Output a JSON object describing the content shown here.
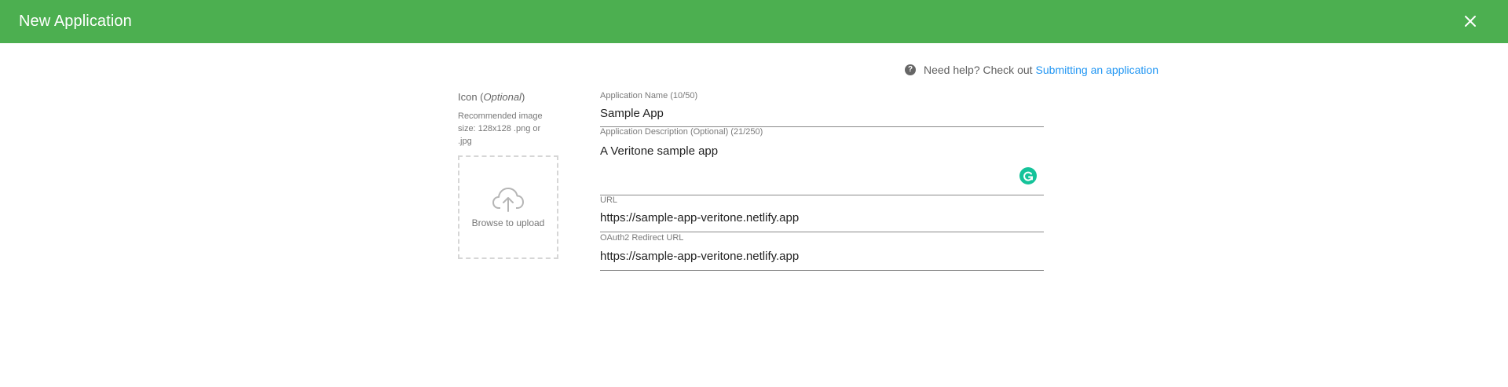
{
  "header": {
    "title": "New Application",
    "accent_color": "#4caf50",
    "close_icon": "close-icon"
  },
  "help": {
    "icon": "question-circle-icon",
    "text": "Need help? Check out",
    "link_text": "Submitting an application",
    "link_color": "#2196f3"
  },
  "icon_section": {
    "label": "Icon (",
    "label_optional": "Optional",
    "label_close": ")",
    "hint": "Recommended image size: 128x128 .png or .jpg",
    "upload_icon": "cloud-upload-icon",
    "upload_text": "Browse to upload"
  },
  "form": {
    "name": {
      "label": "Application Name (10/50)",
      "value": "Sample App"
    },
    "description": {
      "label": "Application Description (Optional) (21/250)",
      "value": "A Veritone sample app"
    },
    "url": {
      "label": "URL",
      "value": "https://sample-app-veritone.netlify.app"
    },
    "oauth": {
      "label": "OAuth2 Redirect URL",
      "value": "https://sample-app-veritone.netlify.app"
    },
    "grammarly_icon": "grammarly-icon",
    "grammarly_color": "#15c39a"
  }
}
